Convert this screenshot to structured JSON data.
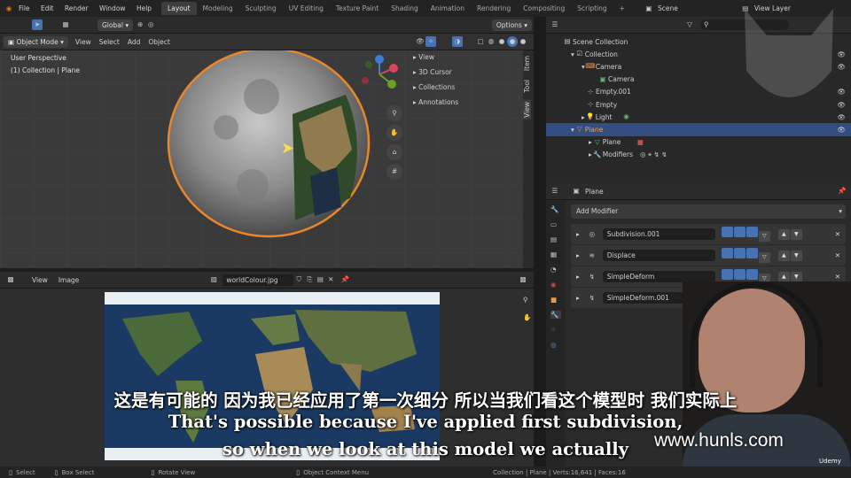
{
  "menu": [
    "File",
    "Edit",
    "Render",
    "Window",
    "Help"
  ],
  "workspaces": [
    "Layout",
    "Modeling",
    "Sculpting",
    "UV Editing",
    "Texture Paint",
    "Shading",
    "Animation",
    "Rendering",
    "Compositing",
    "Scripting"
  ],
  "scene": "Scene",
  "view_layer": "View Layer",
  "viewport": {
    "orientation": "Global",
    "mode": "Object Mode",
    "menus": [
      "View",
      "Select",
      "Add",
      "Object"
    ],
    "options": "Options",
    "info1": "User Perspective",
    "info2": "(1) Collection | Plane",
    "npanel": [
      "View",
      "3D Cursor",
      "Collections",
      "Annotations"
    ],
    "vtabs": [
      "Item",
      "Tool",
      "View"
    ]
  },
  "outliner": {
    "items": [
      "Scene Collection",
      "Collection",
      "Camera",
      "Camera",
      "Empty.001",
      "Empty",
      "Light",
      "Plane",
      "Plane",
      "Modifiers"
    ]
  },
  "properties": {
    "object": "Plane",
    "add_modifier": "Add Modifier",
    "modifiers": [
      "Subdivision.001",
      "Displace",
      "SimpleDeform",
      "SimpleDeform.001"
    ]
  },
  "image_editor": {
    "menus": [
      "View",
      "Image"
    ],
    "image_name": "worldColour.jpg"
  },
  "subtitles": {
    "cn": "这是有可能的 因为我已经应用了第一次细分 所以当我们看这个模型时 我们实际上",
    "en1": "That's possible because I've applied first subdivision,",
    "en2": "so when we look at this model we actually"
  },
  "watermark": "www.hunls.com",
  "brand": "Udemy",
  "status": {
    "select": "Select",
    "box": "Box Select",
    "rotate": "Rotate View",
    "ctx": "Object Context Menu",
    "stats": "Collection | Plane | Verts:16,641 | Faces:16"
  }
}
